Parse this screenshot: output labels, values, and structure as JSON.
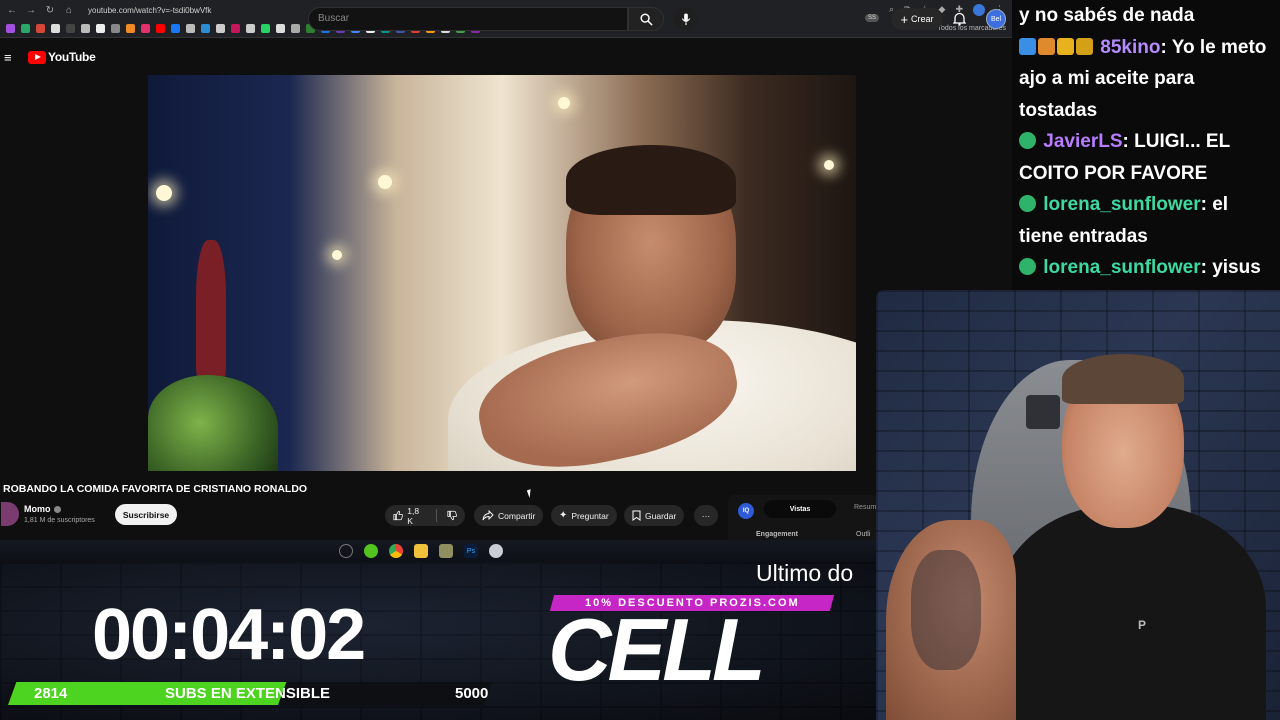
{
  "browser": {
    "url": "youtube.com/watch?v=-tsdi0bwVfk",
    "bookmarks_folder": "Todos los marcadores"
  },
  "youtube": {
    "logo_text": "YouTube",
    "search_placeholder": "Buscar",
    "create_label": "Crear",
    "ss_badge": "SS",
    "avatar_text": "Bel"
  },
  "video": {
    "title": "ROBANDO LA COMIDA FAVORITA DE CRISTIANO RONALDO",
    "channel": "Momo",
    "subscribers": "1,81 M de suscriptores",
    "subscribe_label": "Suscribirse",
    "likes": "1,8 K",
    "share_label": "Compartir",
    "ask_label": "Preguntar",
    "save_label": "Guardar"
  },
  "stats_panel": {
    "logo": "IQ",
    "tab_active": "Vistas",
    "tab_other": "Resum",
    "engagement": "Engagement",
    "outliers": "Outli"
  },
  "overlay": {
    "timer": "00:04:02",
    "subs_current": "2814",
    "subs_label": "SUBS EN EXTENSIBLE",
    "subs_goal": "5000",
    "subs_progress_fraction": 0.563,
    "ticker_text": "Ultimo do",
    "promo_text": "10% DESCUENTO PROZIS.COM",
    "brand_text": "CELL"
  },
  "chat": {
    "top_line": "y no sabés de nada",
    "messages": [
      {
        "user": "85kino",
        "user_color": "#b48cff",
        "text": ": Yo le meto ajo a mi aceite para tostadas"
      },
      {
        "user": "JavierLS",
        "user_color": "#b77cff",
        "text": ": LUIGI... EL COITO POR FAVORE"
      },
      {
        "user": "lorena_sunflower",
        "user_color": "#3dd9a3",
        "text": ": el tiene entradas"
      },
      {
        "user": "lorena_sunflower",
        "user_color": "#3dd9a3",
        "text": ": yisus"
      }
    ]
  },
  "webcam": {
    "shirt_logo": "P"
  }
}
